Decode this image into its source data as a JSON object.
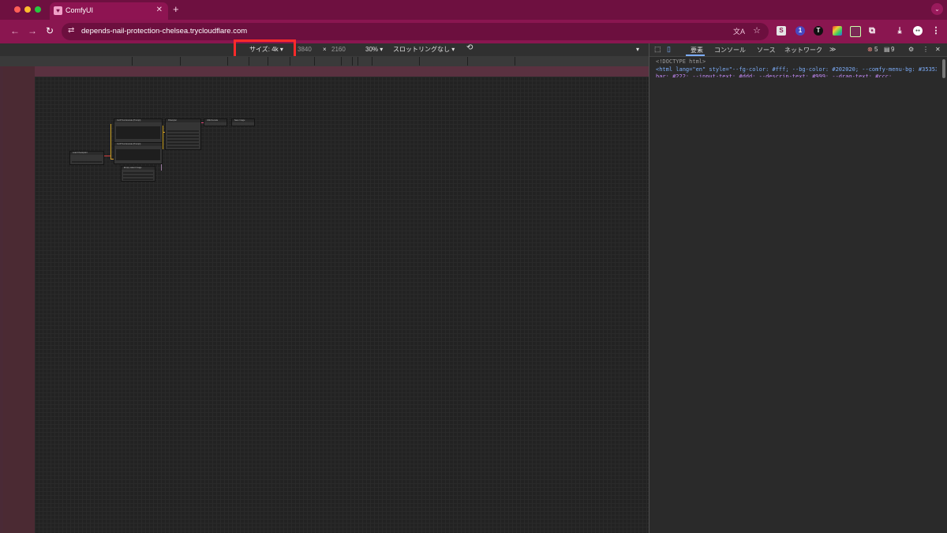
{
  "window": {
    "traffic_lights": {
      "close": "#ff5f57",
      "minimize": "#febc2e",
      "maximize": "#28c840"
    },
    "accent": "#8a1650"
  },
  "tab": {
    "title": "ComfyUI",
    "close_glyph": "✕",
    "favicon": "bear-icon"
  },
  "newtab_glyph": "+",
  "tablist_glyph": "⌄",
  "nav": {
    "back": "←",
    "forward": "→",
    "reload": "↻"
  },
  "omnibox": {
    "url": "depends-nail-protection-chelsea.trycloudflare.com",
    "tune_glyph": "⇄",
    "translate_glyph": "文A",
    "star_glyph": "☆"
  },
  "extensions": [
    {
      "name": "s-extension",
      "glyph": "S",
      "color": "#e5e5e5",
      "text": "#8a1650"
    },
    {
      "name": "badge-extension",
      "glyph": "●",
      "color": "#5050c8",
      "text": "#fff"
    },
    {
      "name": "t-extension",
      "glyph": "T",
      "color": "#111",
      "text": "#fff"
    },
    {
      "name": "color-extension",
      "glyph": "◆",
      "color": "#e8b030",
      "text": "#2a7",
      "badge": ""
    },
    {
      "name": "box-extension",
      "glyph": "▭",
      "color": "#7a2a55",
      "text": "#fff"
    },
    {
      "name": "puzzle-extension",
      "glyph": "⧉",
      "color": "transparent",
      "text": "#fff"
    },
    {
      "name": "download-icon",
      "glyph": "⤓",
      "color": "transparent",
      "text": "#fff"
    },
    {
      "name": "profile-avatar",
      "glyph": "●",
      "color": "#ffffff",
      "text": "#444"
    },
    {
      "name": "menu-icon",
      "glyph": "⋮",
      "color": "transparent",
      "text": "#fff"
    }
  ],
  "device_toolbar": {
    "size_label": "サイズ: 4k ▾",
    "width": "3840",
    "times": "×",
    "height": "2160",
    "zoom": "30% ▾",
    "throttle": "スロットリングなし ▾",
    "rotate_glyph": "⟲",
    "more_glyph": "▾"
  },
  "devtools": {
    "tabs": [
      "要素",
      "コンソール",
      "ソース",
      "ネットワーク",
      "≫"
    ],
    "errors": "5",
    "warnings": "9",
    "code_lines": [
      "<!DOCTYPE html>",
      "<html lang=\"en\" style=\"--fg-color: #fff; --bg-color: #202020; --comfy-menu-bg: #353535; --comfy-input-"
    ]
  },
  "graph": {
    "nodes": [
      "Load Checkpoint",
      "CLIP Text Encode (Prompt)",
      "CLIP Text Encode (Prompt)",
      "KSampler",
      "VAE Decode",
      "Save Image",
      "Empty Latent Image"
    ]
  }
}
